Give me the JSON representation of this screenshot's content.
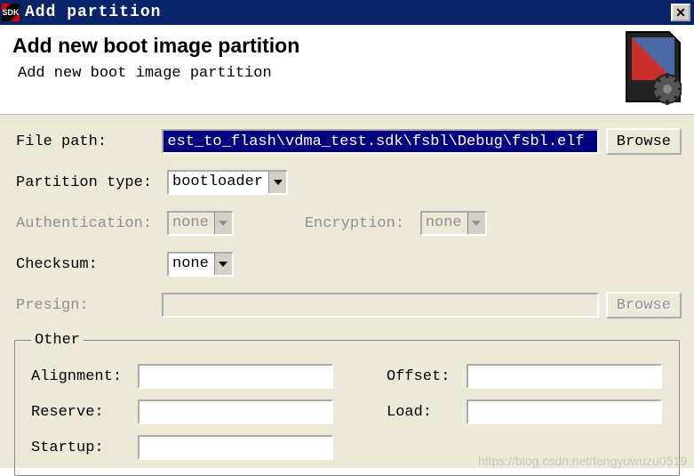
{
  "window": {
    "icon_text": "SDK",
    "title": "Add partition"
  },
  "header": {
    "title": "Add new boot image partition",
    "subtitle": "Add new boot image partition"
  },
  "form": {
    "file_path_label": "File path:",
    "file_path_value": "est_to_flash\\vdma_test.sdk\\fsbl\\Debug\\fsbl.elf",
    "browse_label": "Browse",
    "partition_type_label": "Partition type:",
    "partition_type_value": "bootloader",
    "authentication_label": "Authentication:",
    "authentication_value": "none",
    "encryption_label": "Encryption:",
    "encryption_value": "none",
    "checksum_label": "Checksum:",
    "checksum_value": "none",
    "presign_label": "Presign:",
    "presign_value": "",
    "presign_browse_label": "Browse"
  },
  "other": {
    "legend": "Other",
    "alignment_label": "Alignment:",
    "alignment_value": "",
    "offset_label": "Offset:",
    "offset_value": "",
    "reserve_label": "Reserve:",
    "reserve_value": "",
    "load_label": "Load:",
    "load_value": "",
    "startup_label": "Startup:",
    "startup_value": ""
  },
  "watermark": "https://blog.csdn.net/fengyuwuzu0519"
}
